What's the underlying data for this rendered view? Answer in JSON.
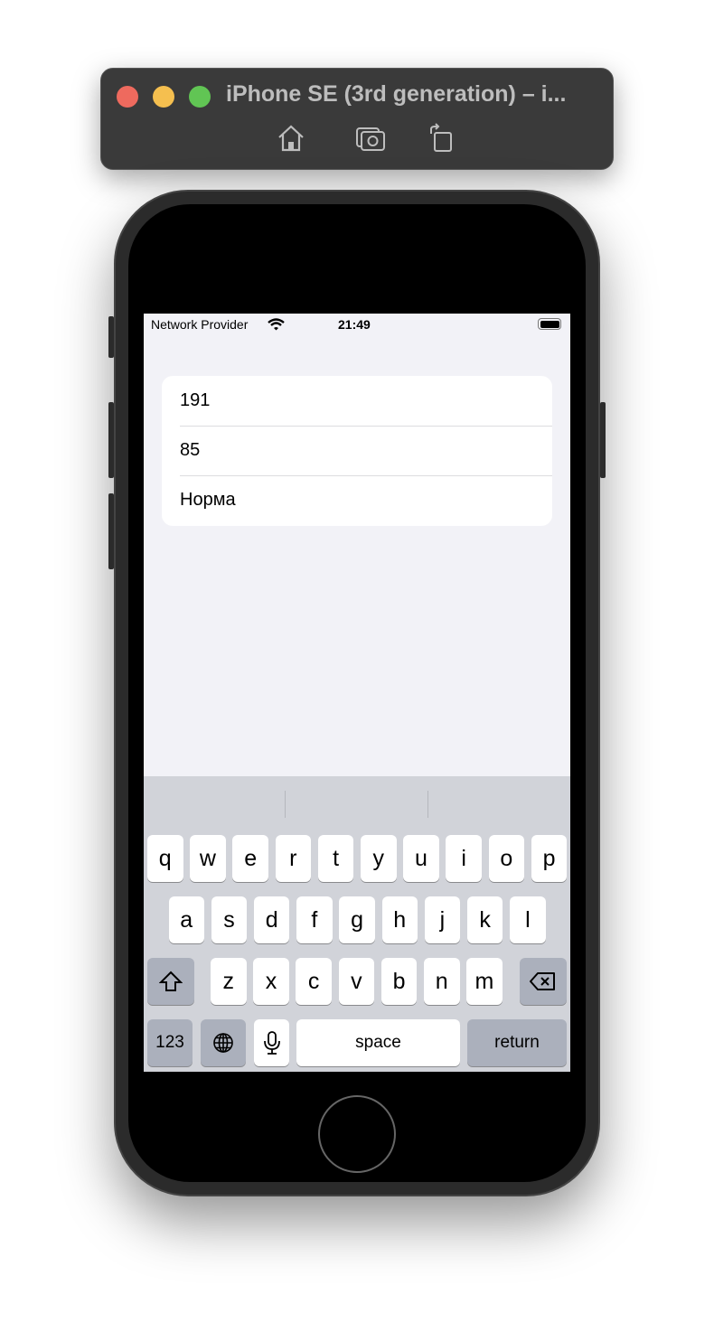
{
  "window": {
    "title": "iPhone SE (3rd generation) – i...",
    "traffic_lights": [
      "#ee6a5e",
      "#f5bf4f",
      "#61c554"
    ],
    "toolbar": [
      "home-icon",
      "screenshot-icon",
      "rotate-icon"
    ]
  },
  "status_bar": {
    "carrier": "Network Provider",
    "time": "21:49",
    "battery_level": 1.0
  },
  "form": {
    "rows": [
      "191",
      "85",
      "Норма"
    ]
  },
  "keyboard": {
    "row1": [
      "q",
      "w",
      "e",
      "r",
      "t",
      "y",
      "u",
      "i",
      "o",
      "p"
    ],
    "row2": [
      "a",
      "s",
      "d",
      "f",
      "g",
      "h",
      "j",
      "k",
      "l"
    ],
    "row3": [
      "z",
      "x",
      "c",
      "v",
      "b",
      "n",
      "m"
    ],
    "numbers_label": "123",
    "space_label": "space",
    "return_label": "return"
  }
}
